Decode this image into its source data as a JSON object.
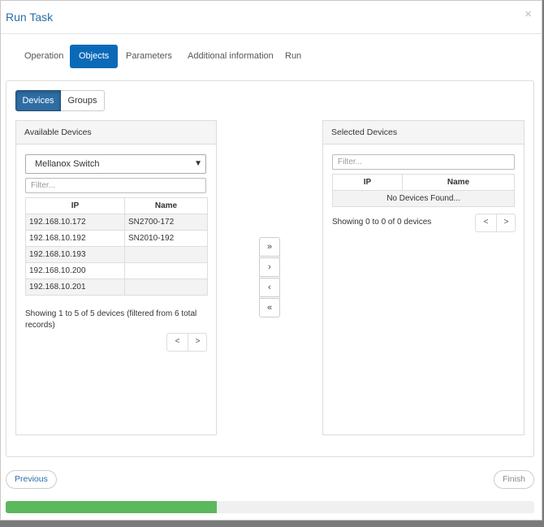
{
  "modal": {
    "title": "Run Task",
    "close": "×"
  },
  "tabs": [
    {
      "label": "Operation",
      "active": false
    },
    {
      "label": "Objects",
      "active": true
    },
    {
      "label": "Parameters",
      "active": false
    },
    {
      "label": "Additional information",
      "active": false
    },
    {
      "label": "Run",
      "active": false
    }
  ],
  "toggle": {
    "devices": "Devices",
    "groups": "Groups",
    "selected": "Devices"
  },
  "available": {
    "heading": "Available Devices",
    "device_type": "Mellanox Switch",
    "caret": "▼",
    "filter_placeholder": "Filter...",
    "columns": {
      "ip": "IP",
      "name": "Name"
    },
    "rows": [
      {
        "ip": "192.168.10.172",
        "name": "SN2700-172"
      },
      {
        "ip": "192.168.10.192",
        "name": "SN2010-192"
      },
      {
        "ip": "192.168.10.193",
        "name": ""
      },
      {
        "ip": "192.168.10.200",
        "name": ""
      },
      {
        "ip": "192.168.10.201",
        "name": ""
      }
    ],
    "info": "Showing 1 to 5 of 5 devices (filtered from 6 total records)",
    "pager": {
      "prev": "<",
      "next": ">"
    }
  },
  "movers": {
    "add_all": "»",
    "add": "›",
    "remove": "‹",
    "remove_all": "«"
  },
  "selected": {
    "heading": "Selected Devices",
    "filter_placeholder": "Filter...",
    "columns": {
      "ip": "IP",
      "name": "Name"
    },
    "empty": "No Devices Found...",
    "info": "Showing 0 to 0 of 0 devices",
    "pager": {
      "prev": "<",
      "next": ">"
    }
  },
  "footer": {
    "previous": "Previous",
    "finish": "Finish"
  },
  "progress": {
    "percent": 40,
    "color": "#5cb85c"
  },
  "colors": {
    "accent": "#0b6ab8",
    "title": "#2a6da8"
  }
}
